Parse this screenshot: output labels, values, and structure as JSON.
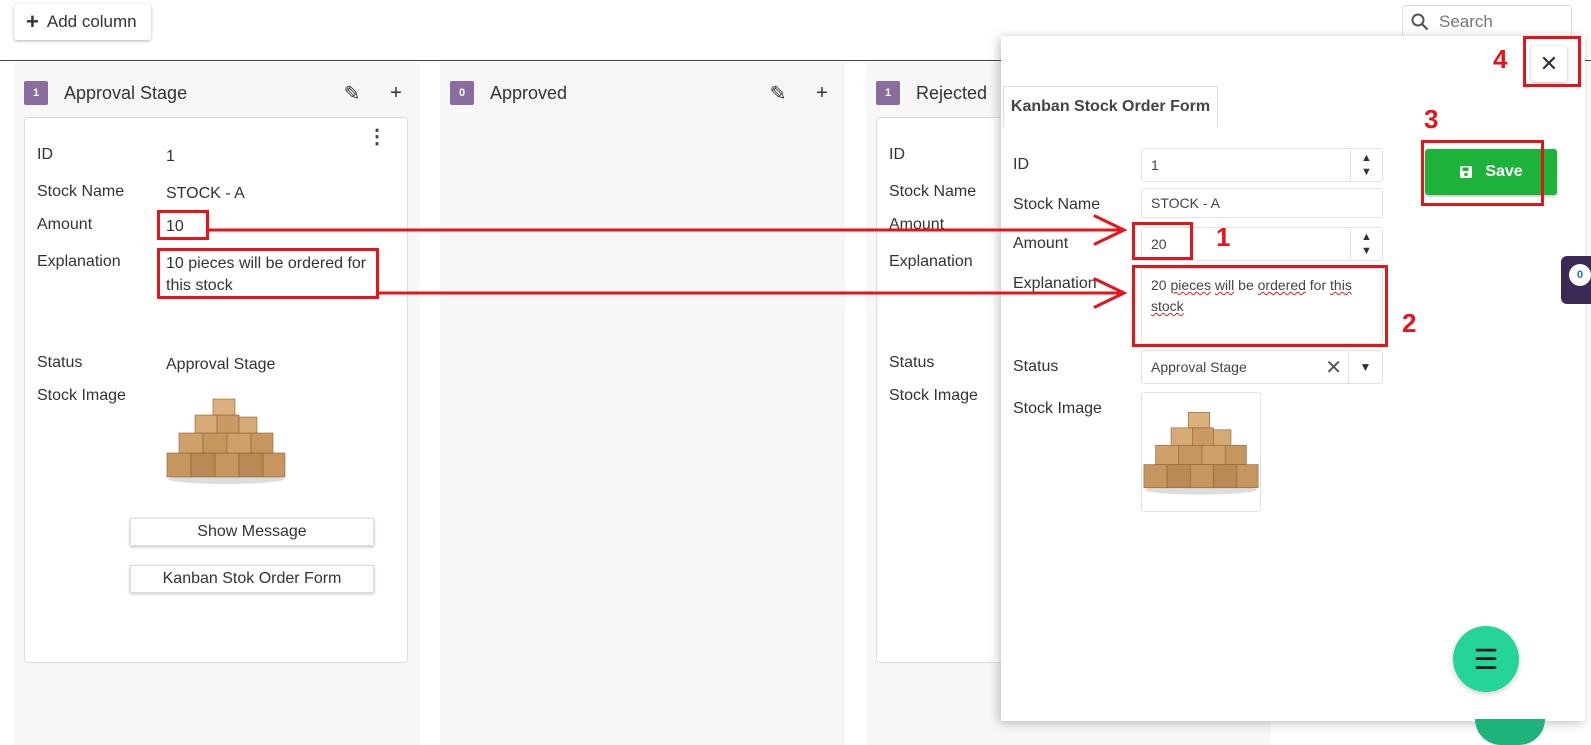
{
  "toolbar": {
    "add_column_label": "Add column",
    "search_placeholder": "Search"
  },
  "columns": [
    {
      "count": "1",
      "title": "Approval Stage",
      "card": {
        "labels": {
          "id": "ID",
          "stock_name": "Stock Name",
          "amount": "Amount",
          "explanation": "Explanation",
          "status": "Status",
          "stock_image": "Stock Image"
        },
        "values": {
          "id": "1",
          "stock_name": "STOCK - A",
          "amount": "10",
          "explanation": "10 pieces will be ordered for this stock",
          "status": "Approval Stage"
        },
        "buttons": {
          "show_message": "Show Message",
          "form": "Kanban Stok Order Form"
        }
      }
    },
    {
      "count": "0",
      "title": "Approved"
    },
    {
      "count": "1",
      "title": "Rejected",
      "card": {
        "labels": {
          "id": "ID",
          "stock_name": "Stock Name",
          "amount": "Amount",
          "explanation": "Explanation",
          "status": "Status",
          "stock_image": "Stock Image"
        }
      }
    }
  ],
  "modal": {
    "tab_label": "Kanban Stock Order Form",
    "labels": {
      "id": "ID",
      "stock_name": "Stock Name",
      "amount": "Amount",
      "explanation": "Explanation",
      "status": "Status",
      "stock_image": "Stock Image"
    },
    "values": {
      "id": "1",
      "stock_name": "STOCK - A",
      "amount": "20",
      "explanation_parts": [
        "20 ",
        "pieces",
        " ",
        "will",
        " be ",
        "ordered",
        " for ",
        "this",
        " stock"
      ],
      "status": "Approval Stage"
    },
    "save_label": "Save"
  },
  "chat_badge": "0",
  "annotations": {
    "n1": "1",
    "n2": "2",
    "n3": "3",
    "n4": "4"
  },
  "colors": {
    "accent_purple": "#8a6d9e",
    "save_green": "#1db33a",
    "fab_green": "#25d49a",
    "annotation_red": "#e3141a"
  },
  "icons": [
    "plus-icon",
    "search-icon",
    "pencil-icon",
    "kebab-icon",
    "close-icon",
    "save-icon",
    "menu-icon",
    "chat-icon"
  ]
}
